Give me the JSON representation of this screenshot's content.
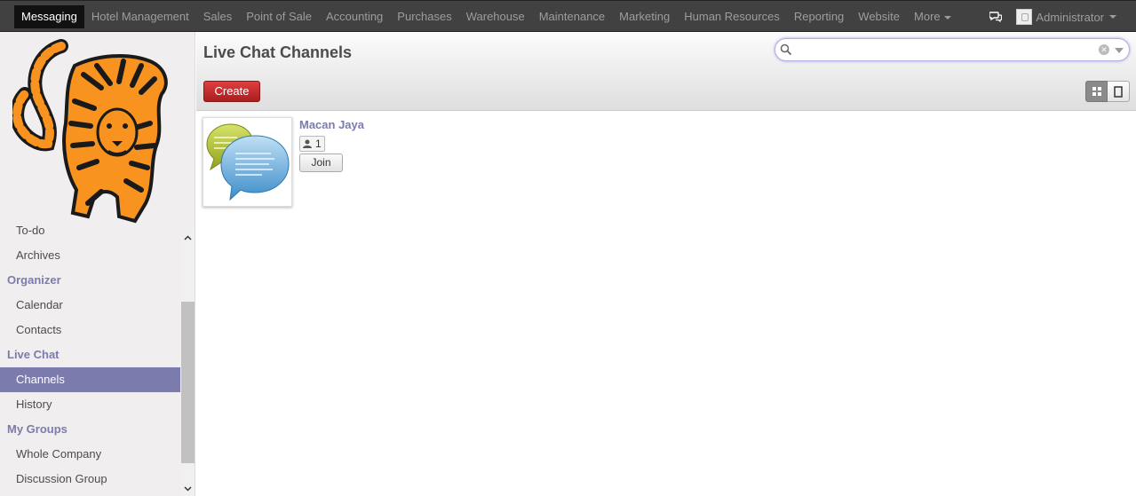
{
  "topbar": {
    "menu": [
      "Messaging",
      "Hotel Management",
      "Sales",
      "Point of Sale",
      "Accounting",
      "Purchases",
      "Warehouse",
      "Maintenance",
      "Marketing",
      "Human Resources",
      "Reporting",
      "Website"
    ],
    "more_label": "More",
    "user_name": "Administrator"
  },
  "sidebar": {
    "partial_item": "To-do",
    "archives": "Archives",
    "organizer_heading": "Organizer",
    "calendar": "Calendar",
    "contacts": "Contacts",
    "livechat_heading": "Live Chat",
    "channels": "Channels",
    "history": "History",
    "mygroups_heading": "My Groups",
    "whole_company": "Whole Company",
    "discussion_group": "Discussion Group"
  },
  "control": {
    "title": "Live Chat Channels",
    "create_label": "Create",
    "search_value": ""
  },
  "channel": {
    "name": "Macan Jaya",
    "members": "1",
    "join_label": "Join"
  },
  "colors": {
    "accent": "#7c7bad",
    "create": "#c0282d",
    "topbar": "#414141"
  }
}
